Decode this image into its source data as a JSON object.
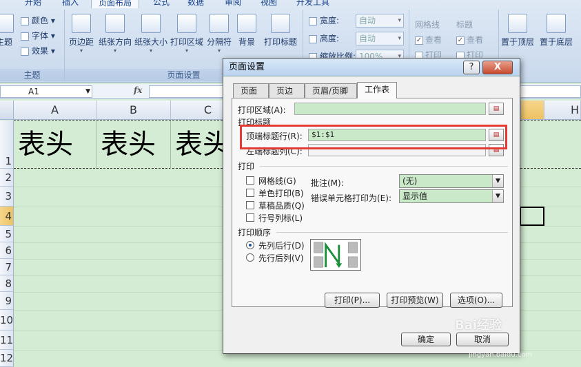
{
  "ribbon": {
    "tabs": [
      "开始",
      "插入",
      "页面布局",
      "公式",
      "数据",
      "审阅",
      "视图",
      "开发工具"
    ],
    "active_tab": "页面布局",
    "theme_group": {
      "items": [
        "颜色",
        "字体",
        "效果"
      ],
      "partial_button": "主题",
      "label": "主题"
    },
    "page_setup_group": {
      "buttons": [
        "页边距",
        "纸张方向",
        "纸张大小",
        "打印区域",
        "分隔符",
        "背景",
        "打印标题"
      ],
      "label": "页面设置"
    },
    "scale_group": {
      "width_label": "宽度:",
      "width_value": "自动",
      "height_label": "高度:",
      "height_value": "自动",
      "scale_label": "缩放比例:",
      "scale_value": "100%"
    },
    "sheet_options": {
      "gridlines_label": "网格线",
      "gridlines_view": "查看",
      "gridlines_print": "打印",
      "headings_label": "标题",
      "headings_view": "查看",
      "headings_print": "打印"
    },
    "arrange": {
      "bring_forward": "置于顶层",
      "send_backward": "置于底层"
    }
  },
  "formula_bar": {
    "name_box": "A1",
    "fx": "fx"
  },
  "sheet": {
    "columns": [
      "A",
      "B",
      "C",
      "H"
    ],
    "rows": [
      "1",
      "2",
      "3",
      "4",
      "5",
      "6",
      "7",
      "8",
      "9",
      "10",
      "11",
      "12"
    ],
    "header_cells": [
      "表头",
      "表头",
      "表头"
    ]
  },
  "dialog": {
    "title": "页面设置",
    "help_btn": "?",
    "close_btn": "X",
    "tabs": [
      "页面",
      "页边距",
      "页眉/页脚",
      "工作表"
    ],
    "active_tab": "工作表",
    "print_area_label": "打印区域(A):",
    "print_titles_label": "打印标题",
    "rows_to_repeat_label": "顶端标题行(R):",
    "rows_to_repeat_value": "$1:$1",
    "cols_to_repeat_label": "左端标题列(C):",
    "print_label": "打印",
    "checkboxes": [
      "网格线(G)",
      "单色打印(B)",
      "草稿品质(Q)",
      "行号列标(L)"
    ],
    "comments_label": "批注(M):",
    "comments_value": "(无)",
    "errors_label": "错误单元格打印为(E):",
    "errors_value": "显示值",
    "page_order_label": "打印顺序",
    "order_options": [
      "先列后行(D)",
      "先行后列(V)"
    ],
    "selected_order": "先列后行(D)",
    "print_button": "打印(P)...",
    "preview_button": "打印预览(W)",
    "options_button": "选项(O)...",
    "ok_button": "确定",
    "cancel_button": "取消"
  },
  "watermark": {
    "text": "Bai经验",
    "sub": "jingyan.baidu.com"
  },
  "colors": {
    "sheet_bg": "#d4ecd4",
    "field_bg": "#c9e9c9",
    "highlight": "#e53935",
    "ribbon": "#dfe9f5"
  }
}
